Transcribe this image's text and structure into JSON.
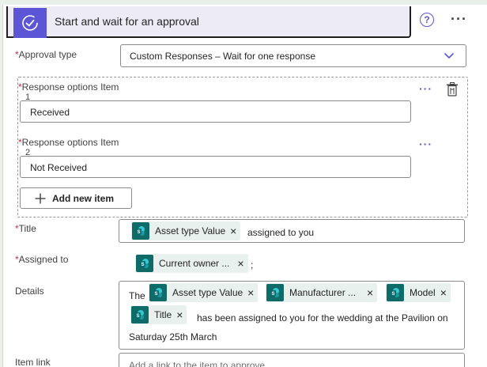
{
  "header": {
    "title": "Start and wait for an approval"
  },
  "approval_type": {
    "label": "Approval type",
    "required_mark": "*",
    "value": "Custom Responses – Wait for one response"
  },
  "response_options": {
    "items": [
      {
        "label": "Response options Item",
        "index": "1",
        "required_mark": "*",
        "value": "Received"
      },
      {
        "label": "Response options Item",
        "index": "2",
        "required_mark": "*",
        "value": "Not Received"
      }
    ],
    "item_menu": "···",
    "add_label": "Add new item"
  },
  "title_field": {
    "label": "Title",
    "required_mark": "*",
    "token": "Asset type Value",
    "suffix": "assigned to you"
  },
  "assigned_to": {
    "label": "Assigned to",
    "required_mark": "*",
    "token": "Current owner ...",
    "suffix": ";"
  },
  "details": {
    "label": "Details",
    "prefix": "The",
    "tokens": [
      "Asset type Value",
      "Manufacturer ...",
      "Model",
      "Title"
    ],
    "text_after": "has been assigned to you for the wedding at the Pavilion on",
    "text_line3": "Saturday 25th March"
  },
  "item_link": {
    "label": "Item link",
    "placeholder": "Add a link to the item to approve"
  },
  "icons": {
    "logo": "approval-check-icon",
    "help": "help-circle-icon",
    "more": "more-options-icon",
    "chevron": "chevron-down-icon",
    "delete": "delete-icon",
    "add": "plus-icon",
    "sharepoint": "sharepoint-icon",
    "remove": "dismiss-icon"
  },
  "colors": {
    "accent": "#5c56d6",
    "header_bg": "#ecebf6",
    "required": "#c4314b",
    "token_bg": "#e8f1ee",
    "sharepoint": "#0e6b67",
    "canvas": "#e9f2ea"
  }
}
